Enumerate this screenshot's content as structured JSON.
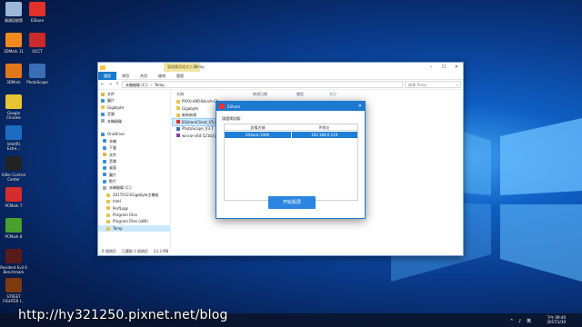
{
  "desktop": {
    "icons": [
      {
        "label": "資源回收筒",
        "color": "#9bb8d8"
      },
      {
        "label": "EShare",
        "color": "#e0312b"
      },
      {
        "label": "3DMark 11",
        "color": "#f08a1c"
      },
      {
        "label": "OCCT",
        "color": "#c92a2a"
      },
      {
        "label": "3DMark",
        "color": "#e2771a"
      },
      {
        "label": "PhotoScape",
        "color": "#3a6fb5"
      },
      {
        "label": "Google Chrome",
        "color": "#e8c333"
      },
      {
        "label": "Intel(R) Extre...",
        "color": "#1d6cc2"
      },
      {
        "label": "Killer Control Center",
        "color": "#222"
      },
      {
        "label": "PCMark 7",
        "color": "#d62c2c"
      },
      {
        "label": "PCMark 8",
        "color": "#4aa02c"
      },
      {
        "label": "Resident Evil 6 Benchmark",
        "color": "#5a1a1a"
      },
      {
        "label": "STREET FIGHTER I...",
        "color": "#7a3b0e"
      }
    ]
  },
  "explorer": {
    "context_tab": "管理應用程式工具",
    "title": "Temp",
    "ribbon_tabs": [
      "檔案",
      "常用",
      "共用",
      "檢視",
      "管理"
    ],
    "address_parts": [
      "本機磁碟 (C:)",
      "Temp"
    ],
    "search_placeholder": "搜尋 Temp",
    "columns": [
      "名稱",
      "修改日期",
      "類型",
      "大小"
    ],
    "nav_items": [
      {
        "label": "文件",
        "color": "#d9b44a"
      },
      {
        "label": "圖片",
        "color": "#3a8fd9"
      },
      {
        "label": "Gigabyte",
        "color": "#e8c04a"
      },
      {
        "label": "音樂",
        "color": "#3a8fd9"
      },
      {
        "label": "本機磁碟",
        "color": "#9aa6b2"
      },
      {
        "label": "",
        "color": "#ffffff"
      },
      {
        "label": "OneDrive",
        "color": "#3a8fd9"
      },
      {
        "label": "本機",
        "color": "#3a8fd9"
      },
      {
        "label": "下載",
        "color": "#3a8fd9"
      },
      {
        "label": "文件",
        "color": "#d9b44a"
      },
      {
        "label": "音樂",
        "color": "#3a8fd9"
      },
      {
        "label": "桌面",
        "color": "#3a8fd9"
      },
      {
        "label": "圖片",
        "color": "#3a8fd9"
      },
      {
        "label": "影片",
        "color": "#3a8fd9"
      },
      {
        "label": "本機磁碟 (C:)",
        "color": "#9aa6b2"
      },
      {
        "label": "20170121Gigabyte主機板",
        "color": "#e8c04a"
      },
      {
        "label": "Intel",
        "color": "#e8c04a"
      },
      {
        "label": "PerfLogs",
        "color": "#e8c04a"
      },
      {
        "label": "Program Files",
        "color": "#e8c04a"
      },
      {
        "label": "Program Files (x86)",
        "color": "#e8c04a"
      },
      {
        "label": "Temp",
        "color": "#e8c04a"
      }
    ],
    "files": [
      {
        "name": "PXXV-ARR-Bench-Ch...",
        "color": "#e8c04a"
      },
      {
        "name": "Gigabyte",
        "color": "#e8c04a"
      },
      {
        "name": "新新新增",
        "color": "#e8c04a"
      },
      {
        "name": "ESshareClient_V1.0.10...",
        "color": "#e0312b"
      },
      {
        "name": "PhotoScape_V3.7",
        "color": "#3a6fb5"
      },
      {
        "name": "winrar-x64-521tc(英中...",
        "color": "#8a3ca8"
      }
    ],
    "status": [
      "6 個項目",
      "已選取 1 個項目",
      "23.3 MB"
    ]
  },
  "eshare": {
    "title": "EShare",
    "prompt": "請選擇設備：",
    "columns": [
      "設備名稱",
      "IP地址"
    ],
    "rows": [
      {
        "device": "EShare-1000",
        "ip": "192.168.0.119"
      }
    ],
    "button": "开始投屏"
  },
  "taskbar": {
    "time": "下午 09:40",
    "date": "2017/1/30",
    "tray": "^ ♪ 英"
  },
  "watermark": "http://hy321250.pixnet.net/blog"
}
